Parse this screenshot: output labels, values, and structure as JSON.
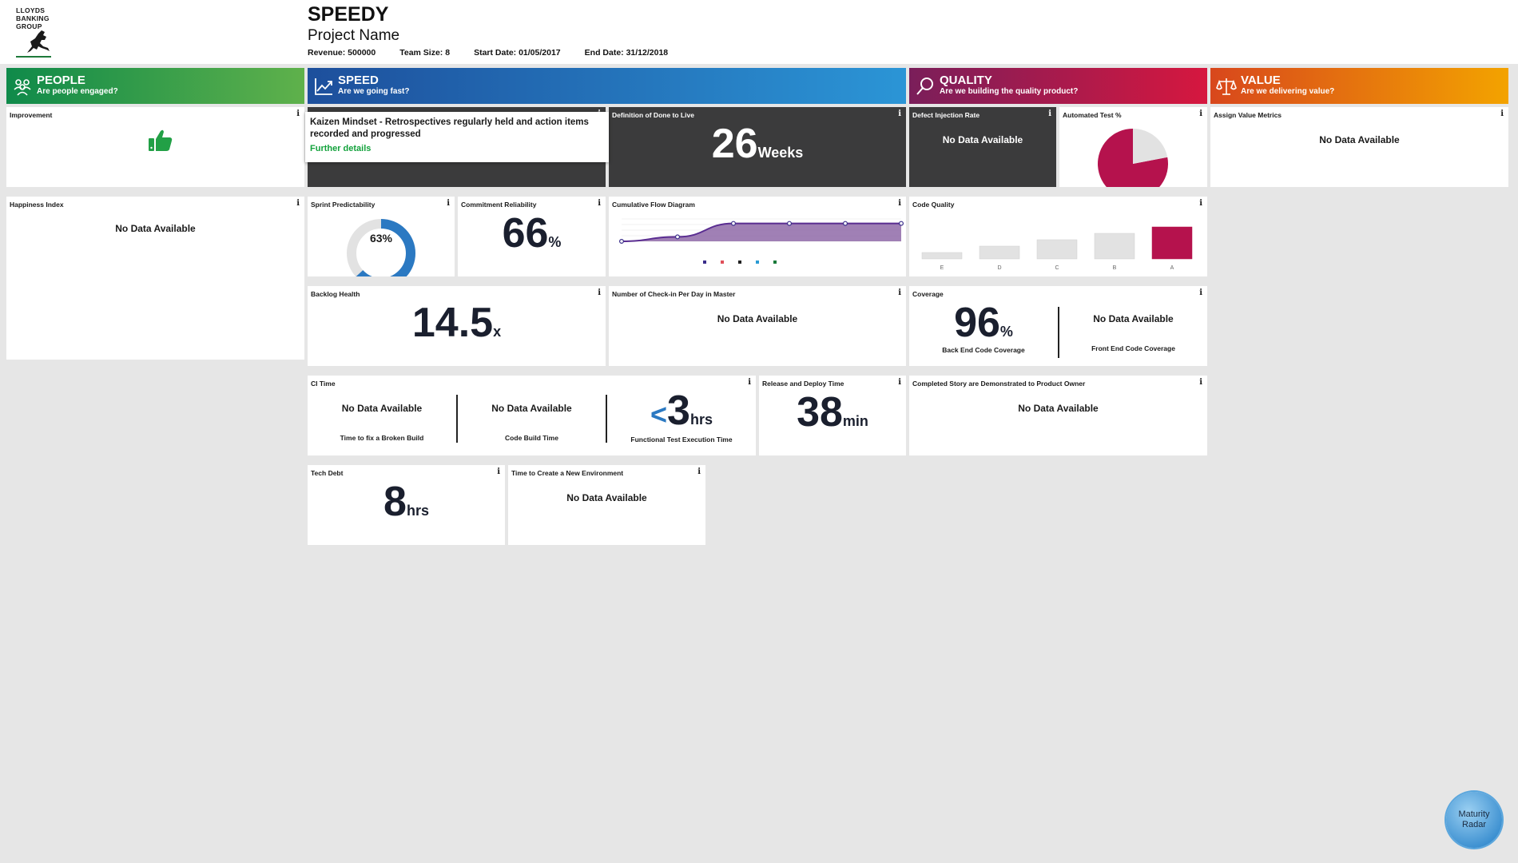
{
  "header": {
    "logo_text": "LLOYDS\nBANKING\nGROUP",
    "title": "SPEEDY",
    "project_name": "Project Name",
    "revenue": "Revenue: 500000",
    "team_size": "Team Size: 8",
    "start_date": "Start Date: 01/05/2017",
    "end_date": "End Date: 31/12/2018"
  },
  "bands": {
    "people": {
      "title": "PEOPLE",
      "subtitle": "Are people engaged?",
      "icon": "people-icon",
      "color": "#0f8a4a"
    },
    "speed": {
      "title": "SPEED",
      "subtitle": "Are we going fast?",
      "icon": "line-chart-icon",
      "color": "#1d4f9c"
    },
    "quality": {
      "title": "QUALITY",
      "subtitle": "Are we building the quality product?",
      "icon": "magnifier-icon",
      "color": "#c2185b"
    },
    "value": {
      "title": "VALUE",
      "subtitle": "Are we delivering value?",
      "icon": "scales-icon",
      "color": "#f08c00"
    }
  },
  "info_glyph": "i",
  "no_data": "No Data Available",
  "cards": {
    "improvement": {
      "title": "Improvement",
      "icon": "thumbs-up-icon"
    },
    "happiness": {
      "title": "Happiness Index"
    },
    "kaizen_popup": {
      "text": "Kaizen Mindset - Retrospectives regularly held and action items recorded and progressed",
      "link": "Further details"
    },
    "dod": {
      "title": "Definition of Done to Live",
      "value": "26",
      "unit": "Weeks"
    },
    "defect": {
      "title": "Defect Injection Rate"
    },
    "automated": {
      "title": "Automated Test %",
      "percent": 78
    },
    "assign_value": {
      "title": "Assign Value Metrics"
    },
    "sprint": {
      "title": "Sprint Predictability",
      "value": "63%",
      "percent": 63
    },
    "commitment": {
      "title": "Commitment Reliability",
      "value": "66",
      "unit": "%"
    },
    "cfd": {
      "title": "Cumulative Flow Diagram"
    },
    "code_quality": {
      "title": "Code Quality"
    },
    "backlog": {
      "title": "Backlog Health",
      "value": "14.5",
      "unit": "x"
    },
    "checkin": {
      "title": "Number of Check-in Per Day in Master"
    },
    "coverage": {
      "title": "Coverage",
      "value": "96",
      "unit": "%",
      "backend_label": "Back End Code Coverage",
      "frontend_label": "Front End Code Coverage"
    },
    "ci_time": {
      "title": "CI Time",
      "broken_label": "Time to fix a Broken Build",
      "build_label": "Code Build Time",
      "lt": "<",
      "value": "3",
      "unit": "hrs",
      "functional_label": "Functional Test Execution Time"
    },
    "release": {
      "title": "Release and Deploy Time",
      "value": "38",
      "unit": "min"
    },
    "completed_story": {
      "title": "Completed Story are Demonstrated to Product Owner"
    },
    "tech_debt": {
      "title": "Tech Debt",
      "value": "8",
      "unit": "hrs"
    },
    "new_env": {
      "title": "Time to Create a New Environment"
    }
  },
  "chart_data": [
    {
      "type": "area",
      "title": "Cumulative Flow Diagram",
      "x": [
        "1",
        "2",
        "3",
        "4",
        "5",
        "6"
      ],
      "series": [
        {
          "values": [
            0,
            25,
            100,
            100,
            100,
            100
          ],
          "color": "#5a2d91"
        }
      ],
      "ylim": [
        0,
        125
      ],
      "legend": [
        "",
        "",
        "",
        "",
        ""
      ],
      "legend_colors": [
        "#3a2d8a",
        "#e0505a",
        "#222222",
        "#2a9bd4",
        "#1a7a3a"
      ]
    },
    {
      "type": "bar",
      "title": "Code Quality",
      "categories": [
        "E",
        "D",
        "C",
        "B",
        "A"
      ],
      "values": [
        1,
        2,
        3,
        4,
        5
      ],
      "highlight": "A",
      "colors": {
        "default": "#e2e2e2",
        "highlight": "#b5124d"
      }
    },
    {
      "type": "pie",
      "title": "Automated Test %",
      "values": [
        78,
        22
      ],
      "colors": [
        "#b5124d",
        "#e2e2e2"
      ]
    }
  ],
  "radar": {
    "label_line1": "Maturity",
    "label_line2": "Radar"
  }
}
